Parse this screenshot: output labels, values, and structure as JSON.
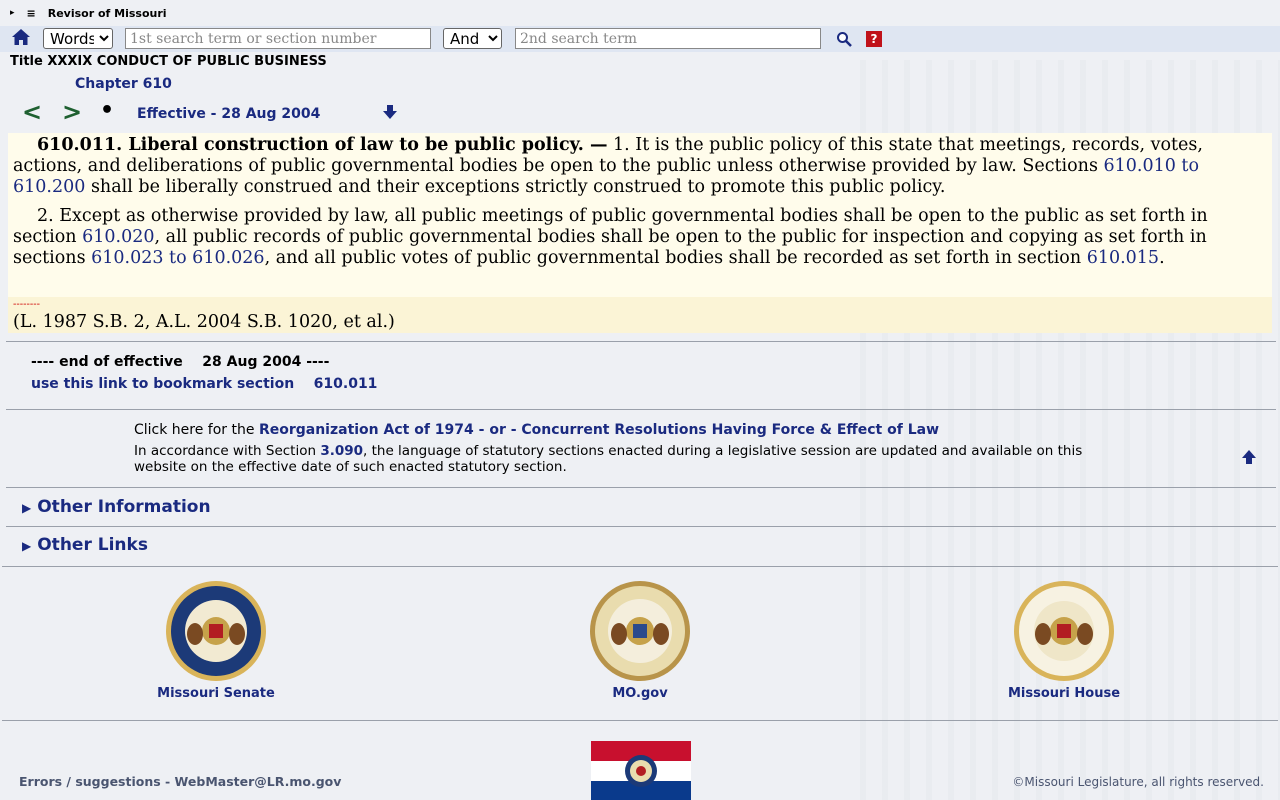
{
  "topbar": {
    "expand_glyph": "▸",
    "menu_glyph": "≡",
    "site_title": "Revisor of Missouri"
  },
  "search": {
    "mode_selected": "Words",
    "mode_options": [
      "Words"
    ],
    "term1_placeholder": "1st search term or section number",
    "operator_selected": "And",
    "operator_options": [
      "And"
    ],
    "term2_placeholder": "2nd search term",
    "help_label": "?"
  },
  "header": {
    "title_line": "Title XXXIX CONDUCT OF PUBLIC BUSINESS",
    "chapter": "Chapter 610",
    "prev_label": "<",
    "next_label": ">",
    "dot_label": "•",
    "effective": "Effective - 28 Aug 2004"
  },
  "section": {
    "heading": "610.011.  Liberal construction of law to be public policy. —",
    "p1_text_a": " 1.  It is the public policy of this state that meetings, records, votes, actions, and deliberations of public governmental bodies be open to the public unless otherwise provided by law.  Sections ",
    "p1_link": "610.010 to 610.200",
    "p1_text_b": " shall be liberally construed and their exceptions strictly construed to promote this public policy.",
    "p2_text_a": "2.  Except as otherwise provided by law, all public meetings of public governmental bodies shall be open to the public as set forth in section ",
    "p2_link1": "610.020",
    "p2_text_b": ", all public records of public governmental bodies shall be open to the public for inspection and copying as set forth in sections ",
    "p2_link2": "610.023 to 610.026",
    "p2_text_c": ", and all public votes of public governmental bodies shall be recorded as set forth in section ",
    "p2_link3": "610.015",
    "p2_text_d": ".",
    "history_dashes": "--------",
    "history": "(L. 1987 S.B. 2, A.L. 2004 S.B. 1020, et al.)"
  },
  "footer_info": {
    "end_effective": "---- end of effective    28 Aug 2004 ----",
    "bookmark": "use this link to bookmark section    610.011",
    "reorg_prefix": "Click here for the ",
    "reorg_link": "Reorganization Act of 1974 - or - Concurrent Resolutions Having Force & Effect of Law",
    "accord_a": "In accordance with Section ",
    "accord_link": "3.090",
    "accord_b": ", the language of statutory sections enacted during a legislative session are updated and available on this website on the effective date of such enacted statutory section."
  },
  "collapsibles": {
    "other_information": "Other Information",
    "other_links": "Other Links"
  },
  "seals": {
    "senate_label": "Missouri Senate",
    "mogov_label": "MO.gov",
    "house_label": "Missouri House"
  },
  "page_footer": {
    "errors": "Errors / suggestions - WebMaster@LR.mo.gov",
    "copyright": "©Missouri Legislature, all rights reserved."
  },
  "colors": {
    "link_navy": "#1a2a80",
    "nav_green": "#1e6030",
    "law_bg": "#fffceb",
    "history_bg": "#fbf4d6",
    "searchbar_bg": "#dfe6f2"
  },
  "icons": [
    "home-icon",
    "search-icon",
    "help-icon",
    "down-arrow-icon",
    "up-arrow-icon",
    "senate-seal-icon",
    "state-seal-icon",
    "house-seal-icon",
    "missouri-flag-icon"
  ]
}
